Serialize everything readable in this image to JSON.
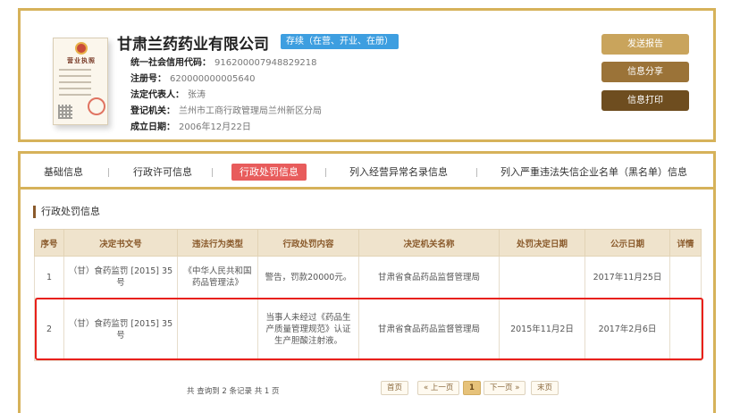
{
  "company": {
    "name": "甘肃兰药药业有限公司",
    "status": "存续（在营、开业、在册）",
    "license_image": {
      "title": "营业执照"
    },
    "fields": [
      {
        "label": "统一社会信用代码：",
        "value": "916200007948829218"
      },
      {
        "label": "注册号：",
        "value": "620000000005640"
      },
      {
        "label": "法定代表人：",
        "value": "张涛"
      },
      {
        "label": "登记机关：",
        "value": "兰州市工商行政管理局兰州新区分局"
      },
      {
        "label": "成立日期：",
        "value": "2006年12月22日"
      }
    ]
  },
  "actions": {
    "report": "发送报告",
    "share": "信息分享",
    "print": "信息打印"
  },
  "tabs": [
    {
      "label": "基础信息",
      "active": false
    },
    {
      "label": "行政许可信息",
      "active": false
    },
    {
      "label": "行政处罚信息",
      "active": true
    },
    {
      "label": "列入经营异常名录信息",
      "active": false
    },
    {
      "label": "列入严重违法失信企业名单（黑名单）信息",
      "active": false
    }
  ],
  "section": {
    "title": "行政处罚信息"
  },
  "table": {
    "headers": [
      "序号",
      "决定书文号",
      "违法行为类型",
      "行政处罚内容",
      "决定机关名称",
      "处罚决定日期",
      "公示日期",
      "详情"
    ],
    "rows": [
      {
        "no": "1",
        "doc_no": "（甘）食药监罚 [2015] 35号",
        "violation": "《中华人民共和国药品管理法》",
        "content": "警告，罚款20000元。",
        "authority": "甘肃省食品药品监督管理局",
        "decision_date": "",
        "publish_date": "2017年11月25日",
        "detail": ""
      },
      {
        "no": "2",
        "doc_no": "（甘）食药监罚 [2015] 35号",
        "violation": "",
        "content": "当事人未经过《药品生产质量管理规范》认证生产胆酸注射液。",
        "authority": "甘肃省食品药品监督管理局",
        "decision_date": "2015年11月2日",
        "publish_date": "2017年2月6日",
        "detail": ""
      }
    ]
  },
  "pagination": {
    "summary": "共 查询到 2 条记录 共 1 页",
    "first": "首页",
    "prev": "« 上一页",
    "current": "1",
    "next": "下一页 »",
    "last": "末页"
  },
  "colors": {
    "border_gold": "#d6b25a",
    "status_blue": "#3d9ee0",
    "active_tab": "#e85c5c",
    "highlight_red": "#e8201b",
    "header_bg": "#efe3cc"
  }
}
